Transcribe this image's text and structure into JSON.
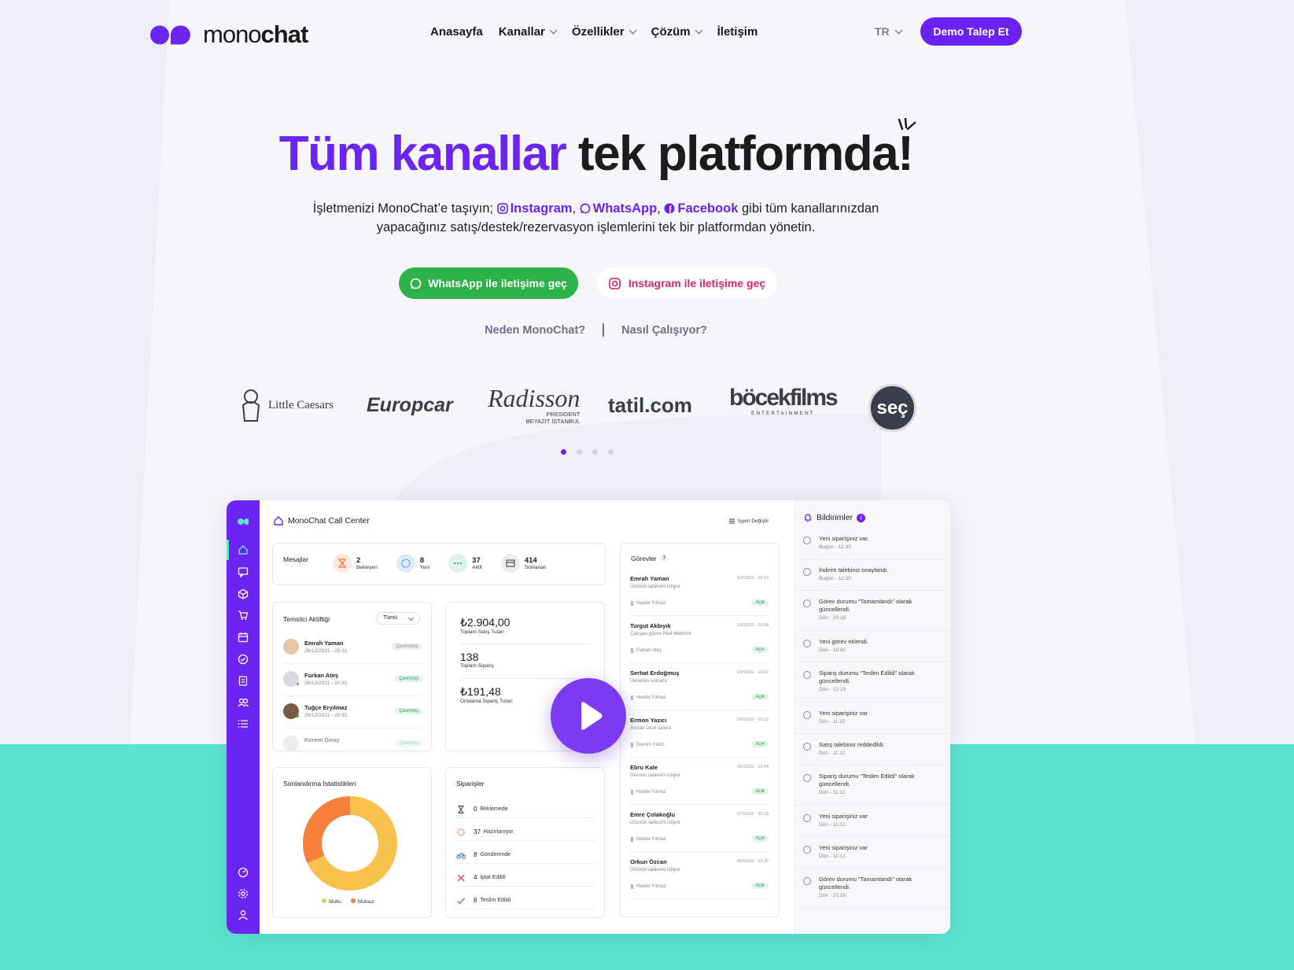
{
  "brand": {
    "logo_lite": "mono",
    "logo_bold": "chat"
  },
  "nav": {
    "items": [
      "Anasayfa",
      "Kanallar",
      "Özellikler",
      "Çözüm",
      "İletişim"
    ],
    "lang": "TR",
    "demo_label": "Demo Talep Et"
  },
  "hero": {
    "title_accent": "Tüm kanallar",
    "title_rest": " tek platformda!",
    "sub_prefix": "İşletmenizi MonoChat’e taşıyın; ",
    "channel_instagram": "Instagram",
    "channel_whatsapp": "WhatsApp",
    "channel_facebook": "Facebook",
    "sub_suffix": " gibi tüm kanallarınızdan",
    "sub_line2": "yapacağınız satış/destek/rezervasyon işlemlerini tek bir platformdan yönetin.",
    "btn_whatsapp": "WhatsApp ile iletişime geç",
    "btn_instagram": "Instagram ile iletişime geç",
    "link_why": "Neden MonoChat?",
    "link_how": "Nasıl Çalışıyor?"
  },
  "brands": [
    "Little Caesars",
    "Europcar",
    "Radisson",
    "PRESIDENT",
    "BEYAZIT İSTANBUL",
    "tatil.com",
    "böcekfilms",
    "ENTERTAINMENT",
    "seç"
  ],
  "carousel": {
    "count": 4,
    "active": 0
  },
  "dashboard": {
    "title": "MonoChat Call Center",
    "switch": "İşyeri Değiştir",
    "messages": {
      "label": "Mesajlar",
      "stats": [
        {
          "n": "2",
          "l": "Bekleyen"
        },
        {
          "n": "8",
          "l": "Yeni"
        },
        {
          "n": "37",
          "l": "Aktif"
        },
        {
          "n": "414",
          "l": "Sonlanan"
        }
      ]
    },
    "reps": {
      "label": "Temsilci Aktifliği",
      "filter": "Tümü",
      "rows": [
        {
          "name": "Emrah Yaman",
          "date": "26/12/2021 - 20:31",
          "status": "Çevrimdışı"
        },
        {
          "name": "Furkan Ateş",
          "date": "26/12/2021 - 20:31",
          "status": "Çevrimiçi"
        },
        {
          "name": "Tuğçe Eryılmaz",
          "date": "26/12/2021 - 20:31",
          "status": "Çevrimiçi"
        },
        {
          "name": "Kerem Giray",
          "date": "",
          "status": "Çevrimiçi"
        }
      ]
    },
    "sales": {
      "total": "₺2.904,00",
      "total_l": "Toplam Satış Tutarı",
      "orders": "138",
      "orders_l": "Toplam Sipariş",
      "avg": "₺191,48",
      "avg_l": "Ortalama Sipariş Tutarı"
    },
    "stats": {
      "label": "Sonlandırma İstatistikleri",
      "legend": [
        "Mutlu",
        "Mutsuz"
      ],
      "happy_share": 0.68,
      "colors": [
        "#f9c24d",
        "#f7803a"
      ]
    },
    "orders": {
      "label": "Siparişler",
      "rows": [
        {
          "n": "0",
          "l": "Beklemede"
        },
        {
          "n": "37",
          "l": "Hazırlanıyor"
        },
        {
          "n": "8",
          "l": "Gönderimde"
        },
        {
          "n": "4",
          "l": "İptal Edildi"
        },
        {
          "n": "8",
          "l": "Teslim Edildi"
        }
      ]
    },
    "tasks": {
      "label": "Görevler",
      "count": "7",
      "rows": [
        {
          "name": "Emrah Yaman",
          "date": "12/03/22 - 16:13",
          "desc": "Ürünün iadesini istiyor",
          "who": "Hande Yılmaz",
          "status": "Açık"
        },
        {
          "name": "Turgut Akbıyık",
          "date": "10/03/22 - 16:08",
          "desc": "Çalışan görev ihlal bildirimi",
          "who": "Furkan Ateş",
          "status": "Açık"
        },
        {
          "name": "Serhat Erdoğmuş",
          "date": "10/03/22 - 12:57",
          "desc": "Denetim sonucu",
          "who": "Hande Yılmaz",
          "status": "Açık"
        },
        {
          "name": "Ermon Yazıcı",
          "date": "09/03/22 - 16:12",
          "desc": "Arızalı ürün iadesi",
          "who": "Devrim Yıldız",
          "status": "Açık"
        },
        {
          "name": "Ebru Kale",
          "date": "09/03/22 - 16:04",
          "desc": "Ürünün iadesini istiyor",
          "who": "Hande Yılmaz",
          "status": "Açık"
        },
        {
          "name": "Emre Çolakoğlu",
          "date": "07/03/22 - 20:18",
          "desc": "Ürünün iadesini istiyor",
          "who": "Hande Yılmaz",
          "status": "Açık"
        },
        {
          "name": "Orkun Özcan",
          "date": "05/03/22 - 12:36",
          "desc": "Ürünün iadesini istiyor",
          "who": "Hande Yılmaz",
          "status": "Açık"
        }
      ]
    },
    "notifications": {
      "label": "Bildirimler",
      "count": "2",
      "rows": [
        {
          "t": "Yeni siparişiniz var.",
          "d": "Bugün - 12:30"
        },
        {
          "t": "İndirim talebiniz onaylandı.",
          "d": "Bugün - 12:30"
        },
        {
          "t": "Görev durumu “Tamamlandı” olarak güncellendi.",
          "d": "Dün - 20:18"
        },
        {
          "t": "Yeni görev eklendi.",
          "d": "Dün - 18:42"
        },
        {
          "t": "Sipariş durumu “Teslim Edildi” olarak güncellendi.",
          "d": "Dün - 12:19"
        },
        {
          "t": "Yeni siparişiniz var",
          "d": "Dün - 11:12"
        },
        {
          "t": "Satış talebiniz reddedildi.",
          "d": "Dün - 11:12"
        },
        {
          "t": "Sipariş durumu “Teslim Edildi” olarak güncellendi.",
          "d": "Dün - 11:12"
        },
        {
          "t": "Yeni siparişiniz var",
          "d": "Dün - 11:12"
        },
        {
          "t": "Yeni siparişiniz var",
          "d": "Dün - 11:12"
        },
        {
          "t": "Görev durumu “Tamamlandı” olarak güncellendi.",
          "d": "Dün - 20:18"
        }
      ]
    }
  },
  "colors": {
    "accent": "#6b24f1",
    "whatsapp": "#2eb34b",
    "teal": "#5be5cc"
  }
}
